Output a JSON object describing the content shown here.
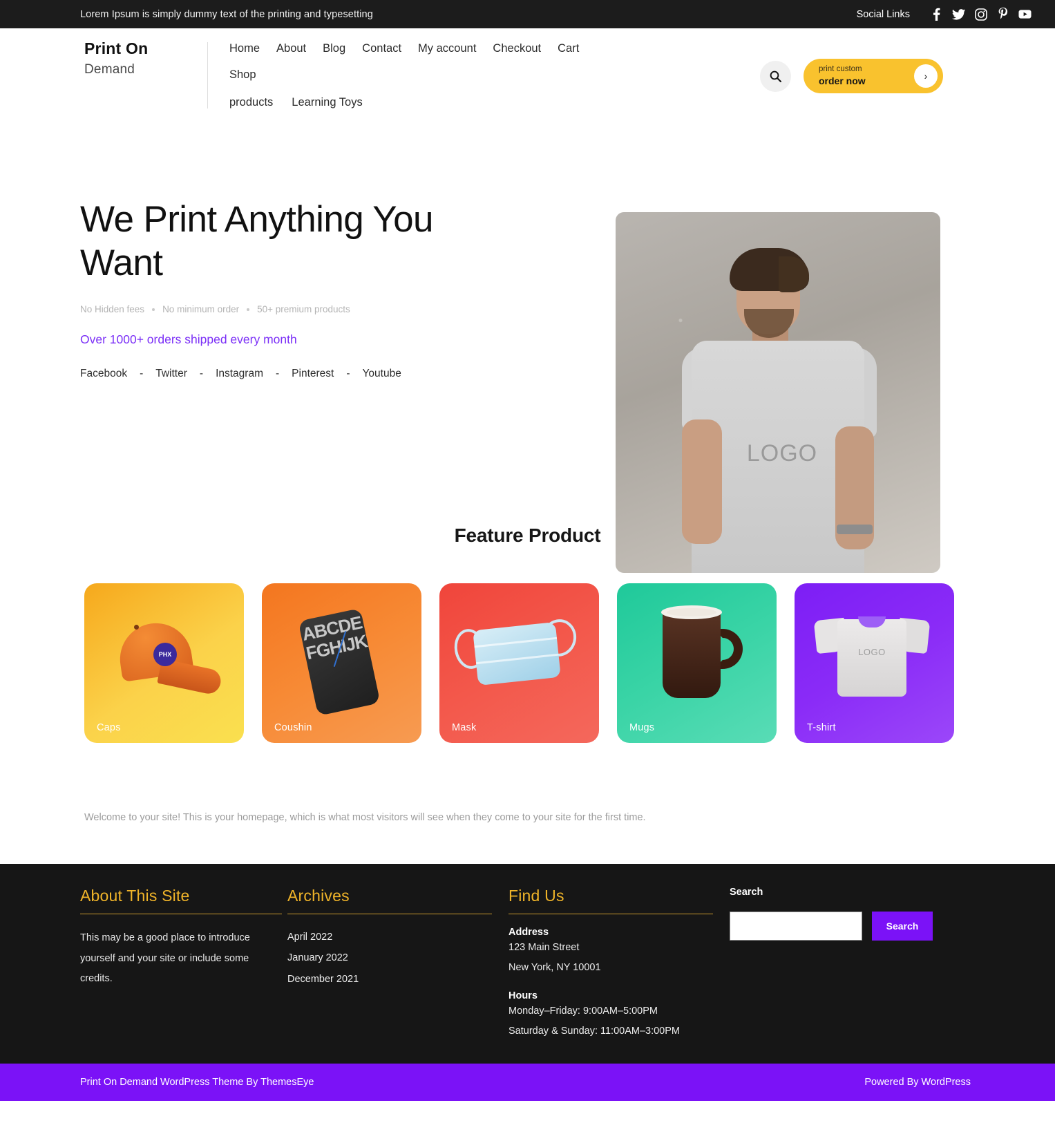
{
  "topbar": {
    "tagline": "Lorem Ipsum is simply dummy text of the printing and typesetting",
    "social_label": "Social Links",
    "social_icons": [
      "facebook-icon",
      "twitter-icon",
      "instagram-icon",
      "pinterest-icon",
      "youtube-icon"
    ]
  },
  "header": {
    "brand_line1": "Print On",
    "brand_line2": "Demand",
    "nav_row1": [
      "Home",
      "About",
      "Blog",
      "Contact",
      "My account",
      "Checkout",
      "Cart",
      "Shop"
    ],
    "nav_row2": [
      "products",
      "Learning Toys"
    ],
    "search_icon": "search-icon",
    "cta_small": "print custom",
    "cta_big": "order now",
    "cta_arrow": "›"
  },
  "hero": {
    "title": "We Print Anything You Want",
    "bullets": [
      "No Hidden fees",
      "No minimum order",
      "50+ premium products"
    ],
    "subline": "Over 1000+ orders shipped every month",
    "socials": [
      "Facebook",
      "Twitter",
      "Instagram",
      "Pinterest",
      "Youtube"
    ],
    "separator": "-",
    "image_logo_text": "LOGO"
  },
  "feature": {
    "title": "Feature Product",
    "cards": [
      {
        "label": "Caps",
        "color": "#f6a81c",
        "cap_logo": "PHX"
      },
      {
        "label": "Coushin",
        "color": "#f4761f",
        "cushion_text": "ABCDE FGHIJKL"
      },
      {
        "label": "Mask",
        "color": "#f0453b"
      },
      {
        "label": "Mugs",
        "color": "#1fc99a"
      },
      {
        "label": "T-shirt",
        "color": "#7d1ef5",
        "shirt_logo": "LOGO"
      }
    ]
  },
  "welcome": {
    "text": "Welcome to your site! This is your homepage, which is what most visitors will see when they come to your site for the first time."
  },
  "footer": {
    "about": {
      "heading": "About This Site",
      "text": "This may be a good place to introduce yourself and your site or include some credits."
    },
    "archives": {
      "heading": "Archives",
      "items": [
        "April 2022",
        "January 2022",
        "December 2021"
      ]
    },
    "find_us": {
      "heading": "Find Us",
      "address_label": "Address",
      "address_line1": "123 Main Street",
      "address_line2": "New York, NY 10001",
      "hours_label": "Hours",
      "hours_line1": "Monday–Friday: 9:00AM–5:00PM",
      "hours_line2": "Saturday & Sunday: 11:00AM–3:00PM"
    },
    "search": {
      "label": "Search",
      "value": "",
      "placeholder": "",
      "button": "Search"
    }
  },
  "bottombar": {
    "left": "Print On Demand WordPress Theme By ThemesEye",
    "right": "Powered By WordPress"
  },
  "colors": {
    "accent_yellow": "#f9c22e",
    "footer_heading": "#f0b429",
    "purple": "#7b12f7",
    "dark": "#161616"
  }
}
